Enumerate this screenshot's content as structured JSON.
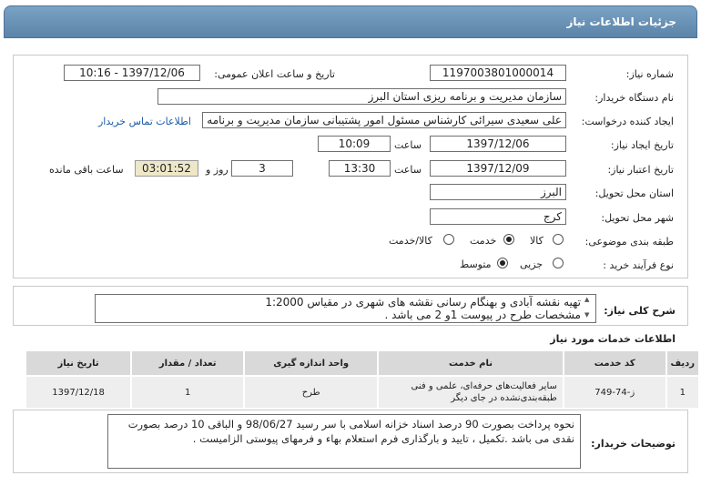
{
  "header": {
    "title": "جزئیات اطلاعات نیاز"
  },
  "form": {
    "need_number_label": "شماره نیاز:",
    "need_number": "1197003801000014",
    "announce_label": "تاریخ و ساعت اعلان عمومی:",
    "announce_value": "1397/12/06 - 10:16",
    "buyer_org_label": "نام دستگاه خریدار:",
    "buyer_org": "سازمان مدیریت و برنامه ریزی استان البرز",
    "requester_label": "ایجاد کننده درخواست:",
    "requester": "علی سعیدی سیرائی کارشناس مسئول امور پشتیبانی سازمان مدیریت و برنامه",
    "contact_link": "اطلاعات تماس خریدار",
    "created_label": "تاریخ ایجاد نیاز:",
    "created_date": "1397/12/06",
    "time_label": "ساعت",
    "created_time": "10:09",
    "validity_label": "تاریخ اعتبار نیاز:",
    "validity_date": "1397/12/09",
    "validity_time": "13:30",
    "days_value": "3",
    "days_label": "روز و",
    "remaining_time": "03:01:52",
    "remaining_label": "ساعت باقی مانده",
    "province_label": "استان محل تحویل:",
    "province": "البرز",
    "city_label": "شهر محل تحویل:",
    "city": "کرج",
    "category_label": "طبقه بندی موضوعی:",
    "category_options": [
      "کالا",
      "خدمت",
      "کالا/خدمت"
    ],
    "category_selected": "خدمت",
    "process_label": "نوع فرآیند خرید :",
    "process_options": [
      "جزیی",
      "متوسط"
    ],
    "process_selected": "متوسط"
  },
  "description": {
    "label": "شرح کلی نیاز:",
    "line1": "تهیه نقشه آبادی و بهنگام رسانی نقشه های شهری در مقیاس 1:2000",
    "line2": "مشخصات طرح در پیوست 1و 2 می باشد ."
  },
  "services": {
    "title": "اطلاعات خدمات مورد نیاز",
    "columns": [
      "ردیف",
      "کد خدمت",
      "نام خدمت",
      "واحد اندازه گیری",
      "تعداد / مقدار",
      "تاریخ نیاز"
    ],
    "rows": [
      {
        "index": "1",
        "code": "ز-74-749",
        "name": "سایر فعالیت‌های حرفه‌ای، علمی و فنی طبقه‌بندی‌نشده در جای دیگر",
        "unit": "طرح",
        "quantity": "1",
        "date": "1397/12/18"
      }
    ]
  },
  "buyer_notes": {
    "label": "توضیحات خریدار:",
    "text": "نحوه پرداخت بصورت 90 درصد اسناد خزانه اسلامی با سر رسید 98/06/27 و الباقی 10 درصد بصورت نقدی می باشد .تکمیل ، تایید و بارگذاری فرم استعلام بهاء و فرمهای پیوستی الزامیست ."
  }
}
